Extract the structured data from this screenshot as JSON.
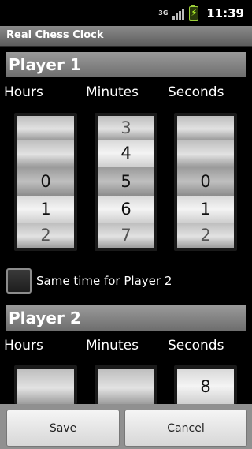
{
  "status_bar": {
    "network_label": "3G",
    "time": "11:39"
  },
  "app": {
    "title": "Real Chess Clock"
  },
  "player1": {
    "header": "Player 1",
    "labels": {
      "hours": "Hours",
      "minutes": "Minutes",
      "seconds": "Seconds"
    },
    "hours": {
      "above2": "",
      "above1": "",
      "selected": "0",
      "below1": "1",
      "below2": "2"
    },
    "minutes": {
      "above2": "3",
      "above1": "4",
      "selected": "5",
      "below1": "6",
      "below2": "7"
    },
    "seconds": {
      "above2": "",
      "above1": "",
      "selected": "0",
      "below1": "1",
      "below2": "2"
    }
  },
  "same_time_checkbox": {
    "label": "Same time for Player 2",
    "checked": false
  },
  "player2": {
    "header": "Player 2",
    "labels": {
      "hours": "Hours",
      "minutes": "Minutes",
      "seconds": "Seconds"
    },
    "hours": {
      "visible": ""
    },
    "minutes": {
      "visible": ""
    },
    "seconds": {
      "visible": "8"
    }
  },
  "buttons": {
    "save": "Save",
    "cancel": "Cancel"
  }
}
